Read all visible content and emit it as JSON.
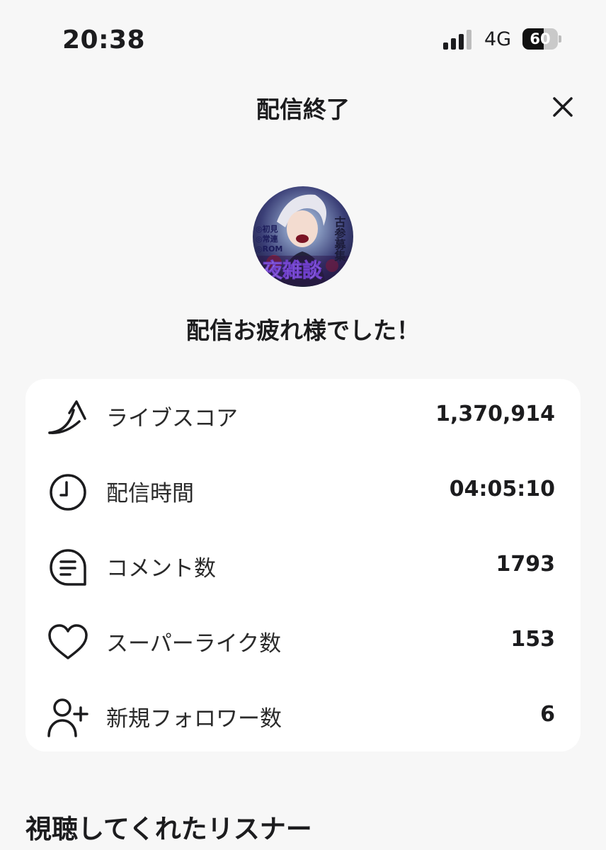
{
  "status_bar": {
    "time": "20:38",
    "network": "4G",
    "battery_level": "60",
    "battery_fraction": 0.6
  },
  "header": {
    "title": "配信終了",
    "close_icon": "close-icon"
  },
  "profile": {
    "avatar_overlay": [
      "古参募集",
      "◎初見",
      "◎常連",
      "◎ROM",
      "夜雑談"
    ],
    "message": "配信お疲れ様でした！"
  },
  "stats": [
    {
      "icon": "trending-arrow-icon",
      "label": "ライブスコア",
      "value": "1,370,914"
    },
    {
      "icon": "clock-icon",
      "label": "配信時間",
      "value": "04:05:10"
    },
    {
      "icon": "comment-icon",
      "label": "コメント数",
      "value": "1793"
    },
    {
      "icon": "heart-icon",
      "label": "スーパーライク数",
      "value": "153"
    },
    {
      "icon": "add-user-icon",
      "label": "新規フォロワー数",
      "value": "6"
    }
  ],
  "listeners": {
    "title": "視聴してくれたリスナー"
  },
  "colors": {
    "background": "#f7f7f7",
    "card": "#ffffff",
    "text": "#1c1c1e"
  }
}
